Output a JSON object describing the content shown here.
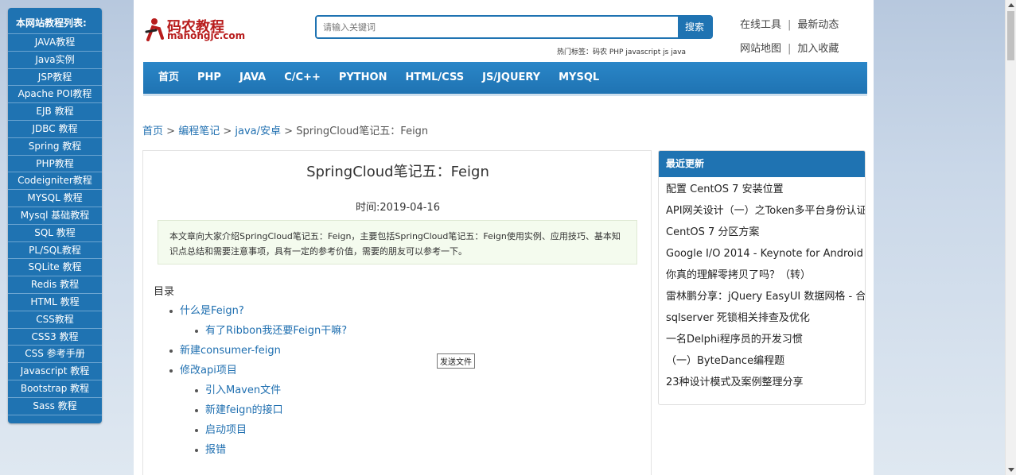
{
  "left_nav": {
    "heading": "本网站教程列表:",
    "items": [
      "JAVA教程",
      "Java实例",
      "JSP教程",
      "Apache POI教程",
      "EJB 教程",
      "JDBC 教程",
      "Spring 教程",
      "PHP教程",
      "Codeigniter教程",
      "MYSQL 教程",
      "Mysql 基础教程",
      "SQL 教程",
      "PL/SQL教程",
      "SQLite 教程",
      "Redis 教程",
      "HTML 教程",
      "CSS教程",
      "CSS3 教程",
      "CSS 参考手册",
      "Javascript 教程",
      "Bootstrap 教程",
      "Sass 教程"
    ]
  },
  "header": {
    "logo_name": "码农教程",
    "logo_domain": "manongjc.com",
    "search_placeholder": "请输入关键词",
    "search_button": "搜索",
    "hot_tags": "热门标签：码农  PHP  javascript  js  java",
    "links_row1": [
      "在线工具",
      "最新动态"
    ],
    "links_row2": [
      "网站地图",
      "加入收藏"
    ],
    "separator": "|"
  },
  "main_nav": [
    "首页",
    "PHP",
    "JAVA",
    "C/C++",
    "PYTHON",
    "HTML/CSS",
    "JS/JQUERY",
    "MYSQL"
  ],
  "breadcrumb": {
    "items": [
      "首页",
      "编程笔记",
      "java/安卓"
    ],
    "sep": ">",
    "current": "SpringCloud笔记五：Feign"
  },
  "article": {
    "title": "SpringCloud笔记五：Feign",
    "time": "时间:2019-04-16",
    "summary": "本文章向大家介绍SpringCloud笔记五：Feign，主要包括SpringCloud笔记五：Feign使用实例、应用技巧、基本知识点总结和需要注意事项，具有一定的参考价值，需要的朋友可以参考一下。",
    "toc_title": "目录",
    "toc": [
      {
        "level": 1,
        "text": "什么是Feign?"
      },
      {
        "level": 2,
        "text": "有了Ribbon我还要Feign干嘛?"
      },
      {
        "level": 1,
        "text": "新建consumer-feign"
      },
      {
        "level": 1,
        "text": "修改api项目"
      },
      {
        "level": 2,
        "text": "引入Maven文件"
      },
      {
        "level": 2,
        "text": "新建feign的接口"
      },
      {
        "level": 2,
        "text": "启动项目"
      },
      {
        "level": 2,
        "text": "报错"
      }
    ]
  },
  "tooltip": "发送文件",
  "sidebar": {
    "heading": "最近更新",
    "items": [
      "配置 CentOS 7 安装位置",
      "API网关设计（一）之Token多平台身份认证",
      "CentOS 7 分区方案",
      "Google I/O 2014 - Keynote for Android",
      "你真的理解零拷贝了吗？（转）",
      "雷林鹏分享：jQuery EasyUI 数据网格 - 合并单元格",
      "sqlserver 死锁相关排查及优化",
      "一名Delphi程序员的开发习惯",
      "（一）ByteDance编程题",
      "23种设计模式及案例整理分享"
    ]
  },
  "colors": {
    "brand_blue": "#1f73b2",
    "logo_red": "#b81c1c",
    "link_blue": "#1f6fb0"
  }
}
